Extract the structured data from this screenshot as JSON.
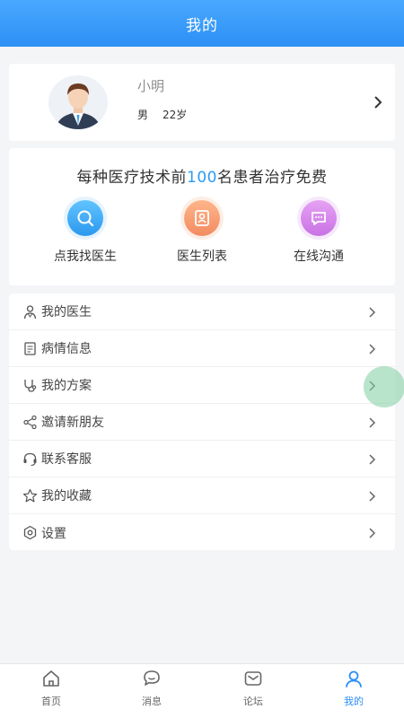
{
  "header": {
    "title": "我的"
  },
  "profile": {
    "name": "小明",
    "gender": "男",
    "age": "22岁"
  },
  "promo": {
    "headline_before": "每种医疗技术前",
    "headline_highlight": "100",
    "headline_after": "名患者治疗免费",
    "actions": [
      {
        "label": "点我找医生",
        "icon": "search-icon"
      },
      {
        "label": "医生列表",
        "icon": "doctor-list-icon"
      },
      {
        "label": "在线沟通",
        "icon": "chat-icon"
      }
    ]
  },
  "menu": {
    "items": [
      {
        "label": "我的医生",
        "icon": "doctor-icon"
      },
      {
        "label": "病情信息",
        "icon": "document-icon"
      },
      {
        "label": "我的方案",
        "icon": "stethoscope-icon"
      },
      {
        "label": "邀请新朋友",
        "icon": "share-icon"
      },
      {
        "label": "联系客服",
        "icon": "headset-icon"
      },
      {
        "label": "我的收藏",
        "icon": "star-icon"
      },
      {
        "label": "设置",
        "icon": "settings-icon"
      }
    ]
  },
  "tabbar": {
    "tabs": [
      {
        "label": "首页",
        "icon": "home-icon",
        "active": false
      },
      {
        "label": "消息",
        "icon": "message-icon",
        "active": false
      },
      {
        "label": "论坛",
        "icon": "forum-icon",
        "active": false
      },
      {
        "label": "我的",
        "icon": "user-icon",
        "active": true
      }
    ]
  },
  "colors": {
    "primary": "#2d8ff5",
    "highlight": "#2b9cf2"
  }
}
